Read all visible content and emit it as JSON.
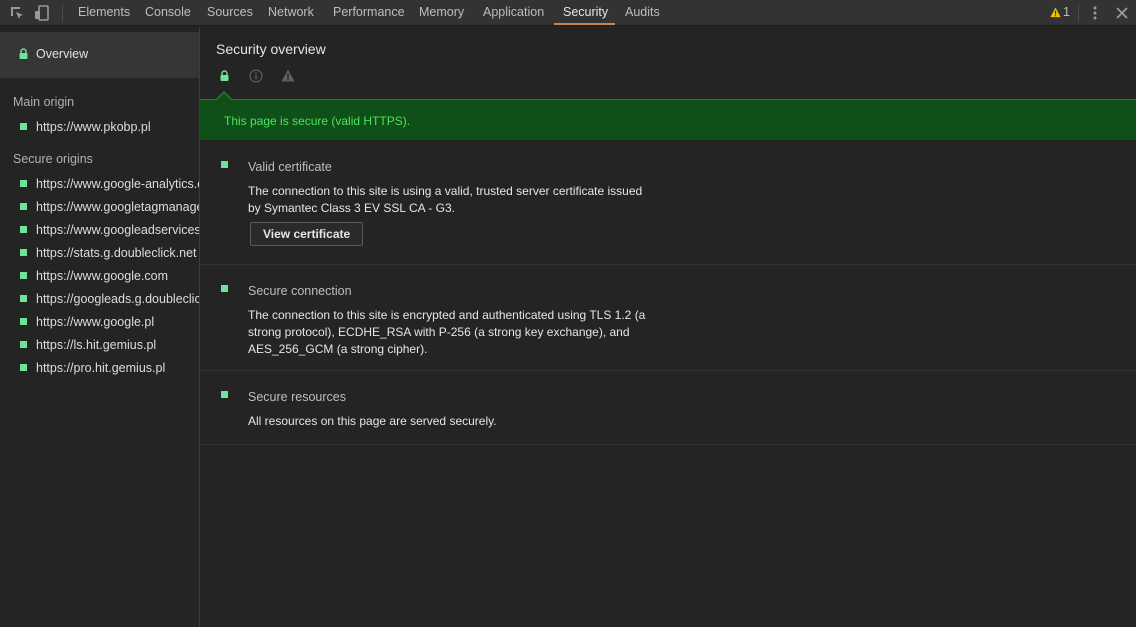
{
  "toolbar": {
    "tabs": [
      {
        "label": "Elements"
      },
      {
        "label": "Console"
      },
      {
        "label": "Sources"
      },
      {
        "label": "Network"
      },
      {
        "label": "Performance"
      },
      {
        "label": "Memory"
      },
      {
        "label": "Application"
      },
      {
        "label": "Security"
      },
      {
        "label": "Audits"
      }
    ],
    "active_tab": "Security",
    "warning_count": "1",
    "icons": [
      "inspect-element-icon",
      "device-toggle-icon",
      "warning-icon",
      "more-options-icon",
      "close-icon"
    ]
  },
  "sidebar": {
    "overview_label": "Overview",
    "main_origin_heading": "Main origin",
    "main_origin": "https://www.pkobp.pl",
    "secure_origins_heading": "Secure origins",
    "secure_origins": [
      "https://www.google-analytics.com",
      "https://www.googletagmanager.com",
      "https://www.googleadservices.com",
      "https://stats.g.doubleclick.net",
      "https://www.google.com",
      "https://googleads.g.doubleclick.net",
      "https://www.google.pl",
      "https://ls.hit.gemius.pl",
      "https://pro.hit.gemius.pl"
    ]
  },
  "main": {
    "title": "Security overview",
    "banner": "This page is secure (valid HTTPS).",
    "sections": [
      {
        "title": "Valid certificate",
        "description": "The connection to this site is using a valid, trusted server certificate issued by Symantec Class 3 EV SSL CA - G3.",
        "button": "View certificate"
      },
      {
        "title": "Secure connection",
        "description": "The connection to this site is encrypted and authenticated using TLS 1.2 (a strong protocol), ECDHE_RSA with P-256 (a strong key exchange), and AES_256_GCM (a strong cipher)."
      },
      {
        "title": "Secure resources",
        "description": "All resources on this page are served securely."
      }
    ]
  },
  "colors": {
    "secure_green": "#4ee35f",
    "banner_bg": "#0f4f18",
    "accent_tab": "#c7864b",
    "warning": "#f5c400"
  }
}
